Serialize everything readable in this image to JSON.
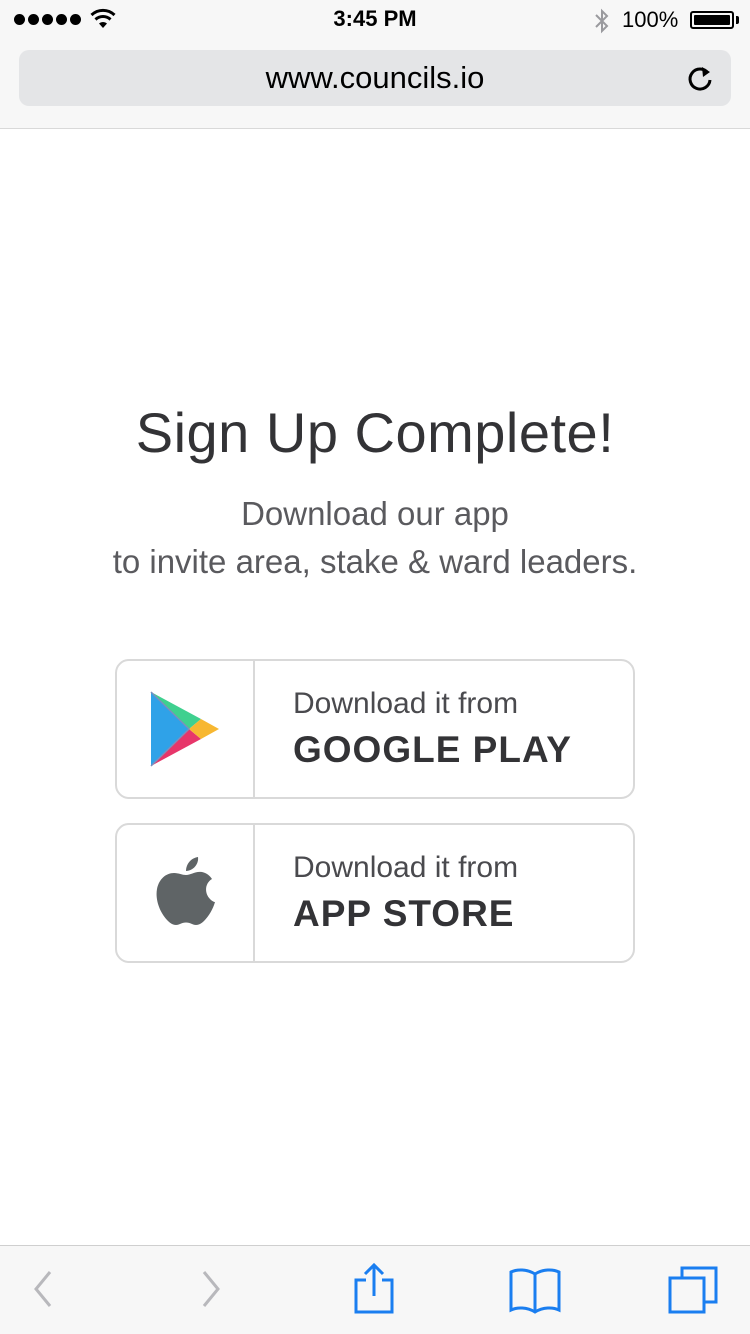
{
  "status_bar": {
    "time": "3:45 PM",
    "battery_percent": "100%",
    "battery_level": 1.0,
    "signal_bars": 5
  },
  "browser": {
    "url": "www.councils.io"
  },
  "content": {
    "title": "Sign Up Complete!",
    "subtitle_line1": "Download our app",
    "subtitle_line2": "to invite area, stake & ward leaders."
  },
  "stores": [
    {
      "line1": "Download it from",
      "line2": "GOOGLE PLAY",
      "icon": "google-play-icon"
    },
    {
      "line1": "Download it from",
      "line2": "APP STORE",
      "icon": "apple-icon"
    }
  ],
  "toolbar": {
    "icons": [
      "back-icon",
      "forward-icon",
      "share-icon",
      "bookmarks-icon",
      "tabs-icon"
    ],
    "accent_color": "#1a7ef0",
    "disabled_color": "#b8b8bc"
  }
}
